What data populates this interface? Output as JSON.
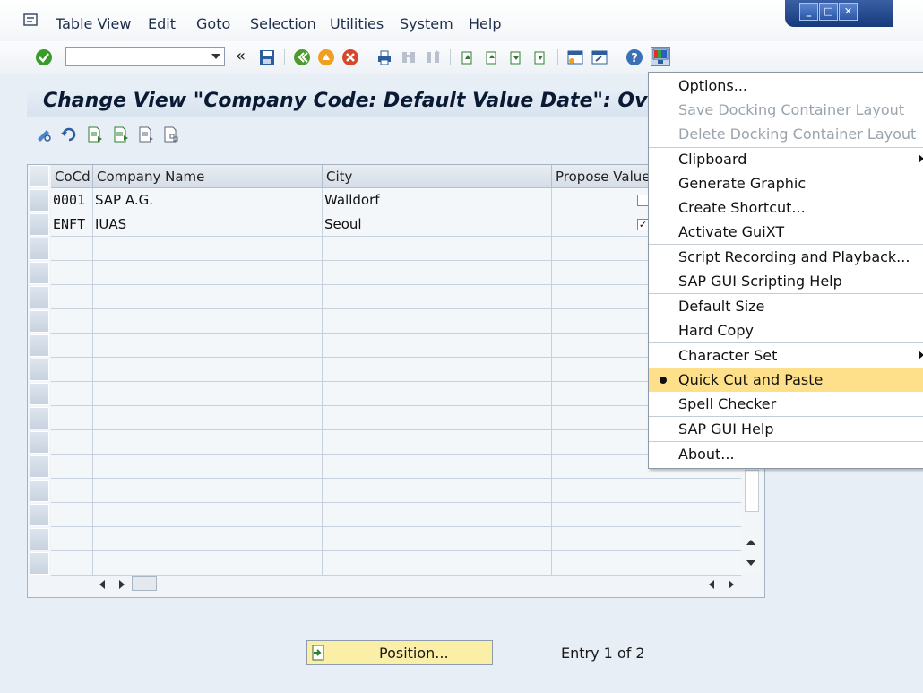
{
  "menubar": {
    "items": [
      "Table View",
      "Edit",
      "Goto",
      "Selection",
      "Utilities",
      "System",
      "Help"
    ]
  },
  "window_controls": [
    "minimize",
    "maximize",
    "close"
  ],
  "toolbar": {
    "command_field": {
      "value": ""
    }
  },
  "screen": {
    "title": "Change View \"Company Code: Default Value Date\": Overvi"
  },
  "table": {
    "headers": [
      "CoCd",
      "Company Name",
      "City",
      "Propose Value"
    ],
    "rows": [
      {
        "cocd": "0001",
        "name": "SAP A.G.",
        "city": "Walldorf",
        "propose": false
      },
      {
        "cocd": "ENFT",
        "name": "IUAS",
        "city": "Seoul",
        "propose": true
      }
    ]
  },
  "context_menu": {
    "items": [
      {
        "label": "Options...",
        "disabled": false
      },
      {
        "label": "Save Docking Container Layout",
        "disabled": true
      },
      {
        "label": "Delete Docking Container Layout",
        "disabled": true
      },
      {
        "label": "Clipboard",
        "submenu": true
      },
      {
        "label": "Generate Graphic"
      },
      {
        "label": "Create Shortcut..."
      },
      {
        "label": "Activate GuiXT"
      },
      {
        "label": "Script Recording and Playback..."
      },
      {
        "label": "SAP GUI Scripting Help"
      },
      {
        "label": "Default Size"
      },
      {
        "label": "Hard Copy"
      },
      {
        "label": "Character Set",
        "submenu": true
      },
      {
        "label": "Quick Cut and Paste",
        "selected": true
      },
      {
        "label": "Spell Checker"
      },
      {
        "label": "SAP GUI Help"
      },
      {
        "label": "About..."
      }
    ]
  },
  "footer": {
    "position_button": "Position...",
    "entry_text": "Entry 1 of 2"
  }
}
